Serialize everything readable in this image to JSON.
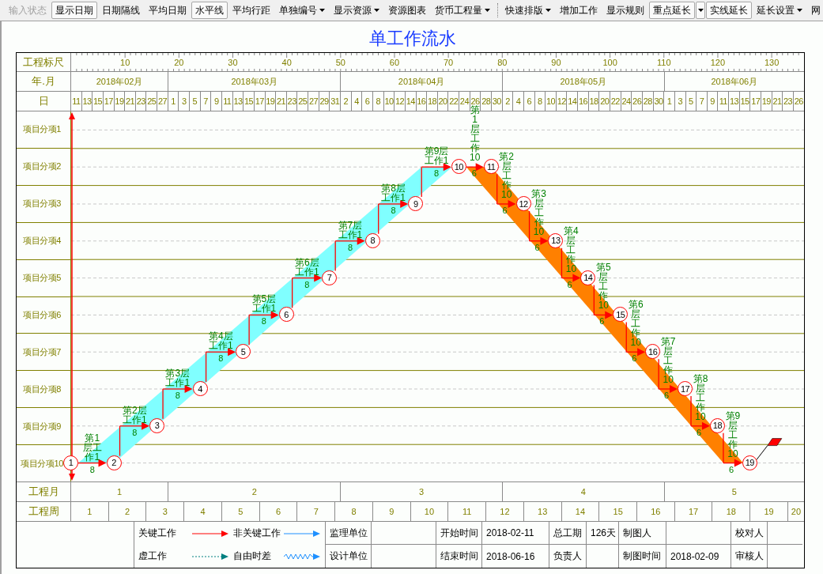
{
  "toolbar": [
    {
      "items": [
        {
          "label": "输入状态",
          "disabled": true,
          "pressed": false,
          "dropdown": false
        },
        {
          "label": "显示日期",
          "disabled": false,
          "pressed": true,
          "dropdown": false
        },
        {
          "label": "日期隔线",
          "disabled": false,
          "pressed": false,
          "dropdown": false
        },
        {
          "label": "平均日期",
          "disabled": false,
          "pressed": false,
          "dropdown": false
        },
        {
          "label": "水平线",
          "disabled": false,
          "pressed": true,
          "dropdown": false
        },
        {
          "label": "平均行距",
          "disabled": false,
          "pressed": false,
          "dropdown": false
        },
        {
          "label": "单独编号",
          "disabled": false,
          "pressed": false,
          "dropdown": true
        },
        {
          "label": "显示资源",
          "disabled": false,
          "pressed": false,
          "dropdown": true
        },
        {
          "label": "资源图表",
          "disabled": false,
          "pressed": false,
          "dropdown": false
        },
        {
          "label": "货币工程量",
          "disabled": false,
          "pressed": false,
          "dropdown": true
        }
      ]
    },
    {
      "items": [
        {
          "label": "快速排版",
          "disabled": false,
          "pressed": false,
          "dropdown": true
        },
        {
          "label": "增加工作",
          "disabled": false,
          "pressed": false,
          "dropdown": false
        },
        {
          "label": "显示规则",
          "disabled": false,
          "pressed": false,
          "dropdown": false
        },
        {
          "label": "重点延长",
          "disabled": false,
          "pressed": true,
          "dropdown": true
        },
        {
          "label": "实线延长",
          "disabled": false,
          "pressed": true,
          "dropdown": false
        },
        {
          "label": "延长设置",
          "disabled": false,
          "pressed": false,
          "dropdown": true
        },
        {
          "label": "网",
          "disabled": false,
          "pressed": false,
          "dropdown": false
        }
      ]
    }
  ],
  "title": "单工作流水",
  "scale": {
    "label": "工程标尺",
    "ticks": [
      "10",
      "20",
      "30",
      "40",
      "50",
      "60",
      "70",
      "80",
      "90",
      "100",
      "110",
      "120",
      "130"
    ]
  },
  "calendar": {
    "month_label": "年.月",
    "day_label": "日",
    "months": [
      {
        "label": "2018年02月",
        "days": [
          "11",
          "13",
          "15",
          "17",
          "19",
          "21",
          "23",
          "25",
          "27"
        ]
      },
      {
        "label": "2018年03月",
        "days": [
          "1",
          "3",
          "5",
          "7",
          "9",
          "11",
          "13",
          "15",
          "17",
          "19",
          "21",
          "23",
          "25",
          "27",
          "29",
          "31"
        ]
      },
      {
        "label": "2018年04月",
        "days": [
          "2",
          "4",
          "6",
          "8",
          "10",
          "12",
          "14",
          "16",
          "18",
          "20",
          "22",
          "24",
          "26",
          "28",
          "30"
        ]
      },
      {
        "label": "2018年05月",
        "days": [
          "2",
          "4",
          "6",
          "8",
          "10",
          "12",
          "14",
          "16",
          "18",
          "20",
          "22",
          "24",
          "26",
          "28",
          "30"
        ]
      },
      {
        "label": "2018年06月",
        "days": [
          "1",
          "3",
          "5",
          "7",
          "9",
          "11",
          "13",
          "15",
          "17",
          "19",
          "21",
          "23",
          "26"
        ]
      }
    ]
  },
  "rows": [
    "项目分项1",
    "项目分项2",
    "项目分项3",
    "项目分项4",
    "项目分项5",
    "项目分项6",
    "项目分项7",
    "项目分项8",
    "项目分项9",
    "项目分项10"
  ],
  "nodes": [
    "1",
    "2",
    "3",
    "4",
    "5",
    "6",
    "7",
    "8",
    "9",
    "10",
    "11",
    "12",
    "13",
    "14",
    "15",
    "16",
    "17",
    "18",
    "19"
  ],
  "sections": [
    {
      "kind": "rising",
      "color": "#80ffff",
      "tasks": [
        {
          "name": "第1层工作1",
          "duration": "8"
        },
        {
          "name": "第2层工作1",
          "duration": "8"
        },
        {
          "name": "第3层工作1",
          "duration": "8"
        },
        {
          "name": "第4层工作1",
          "duration": "8"
        },
        {
          "name": "第5层工作1",
          "duration": "8"
        },
        {
          "name": "第6层工作1",
          "duration": "8"
        },
        {
          "name": "第7层工作1",
          "duration": "8"
        },
        {
          "name": "第8层工作1",
          "duration": "8"
        },
        {
          "name": "第9层工作1",
          "duration": "8"
        }
      ]
    },
    {
      "kind": "falling",
      "color": "#ff8000",
      "tasks": [
        {
          "name": "第1层工作10",
          "duration": "6"
        },
        {
          "name": "第2层工作10",
          "duration": "6"
        },
        {
          "name": "第3层工作10",
          "duration": "6"
        },
        {
          "name": "第4层工作10",
          "duration": "6"
        },
        {
          "name": "第5层工作10",
          "duration": "6"
        },
        {
          "name": "第6层工作10",
          "duration": "6"
        },
        {
          "name": "第7层工作10",
          "duration": "6"
        },
        {
          "name": "第8层工作10",
          "duration": "6"
        },
        {
          "name": "第9层工作10",
          "duration": "6"
        }
      ]
    }
  ],
  "project_months": {
    "label": "工程月",
    "items": [
      "1",
      "2",
      "3",
      "4",
      "5"
    ]
  },
  "project_weeks": {
    "label": "工程周",
    "items": [
      "1",
      "2",
      "3",
      "4",
      "5",
      "6",
      "7",
      "8",
      "9",
      "10",
      "11",
      "12",
      "13",
      "14",
      "15",
      "16",
      "17",
      "18",
      "19",
      "20"
    ]
  },
  "legend": [
    {
      "label": "关键工作",
      "kind": "critical"
    },
    {
      "label": "非关键工作",
      "kind": "noncritical"
    },
    {
      "label": "虚工作",
      "kind": "dummy"
    },
    {
      "label": "自由时差",
      "kind": "float"
    }
  ],
  "info": [
    [
      {
        "label": "监理单位"
      },
      {
        "label": "开始时间",
        "value": "2018-02-11"
      },
      {
        "label": "总工期",
        "value": "126天"
      },
      {
        "label": "制图人"
      },
      {
        "label": "校对人"
      }
    ],
    [
      {
        "label": "设计单位"
      },
      {
        "label": "结束时间",
        "value": "2018-06-16"
      },
      {
        "label": "负责人"
      },
      {
        "label": "制图时间",
        "value": "2018-02-09"
      },
      {
        "label": "审核人"
      }
    ]
  ]
}
